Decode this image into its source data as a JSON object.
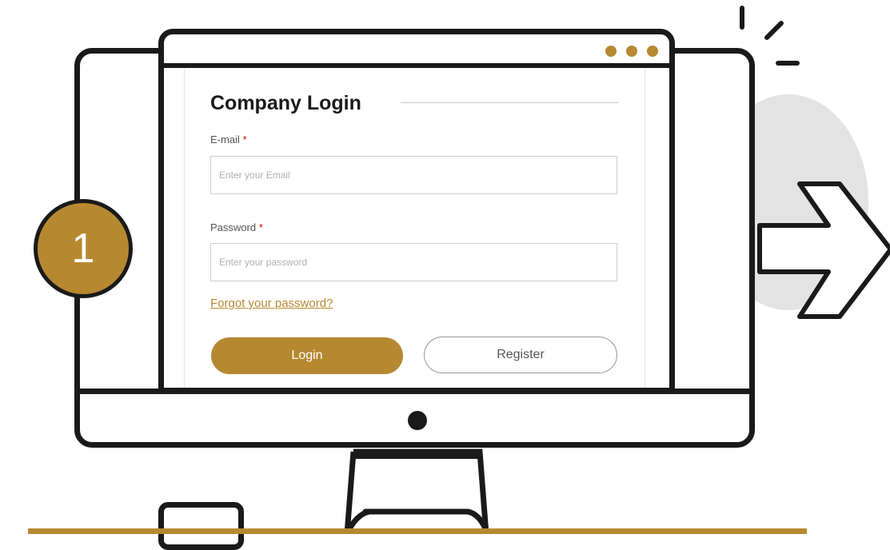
{
  "colors": {
    "accent": "#b68931",
    "outline": "#1a1a1a",
    "decor_grey": "#e3e3e3",
    "required": "#d10000"
  },
  "step": {
    "number": "1"
  },
  "browser": {
    "dots": [
      "dot",
      "dot",
      "dot"
    ]
  },
  "login_form": {
    "title": "Company Login",
    "email_label": "E-mail",
    "email_required": "*",
    "email_placeholder": "Enter your Email",
    "email_value": "",
    "password_label": "Password",
    "password_required": "*",
    "password_placeholder": "Enter your password",
    "password_value": "",
    "forgot_link": "Forgot your password?",
    "login_button": "Login",
    "register_button": "Register"
  },
  "icons": {
    "step": "step-number-badge",
    "arrow": "chevron-arrow-right-icon",
    "sparkle": "sparkle-lines-icon",
    "camera": "webcam-dot-icon"
  }
}
